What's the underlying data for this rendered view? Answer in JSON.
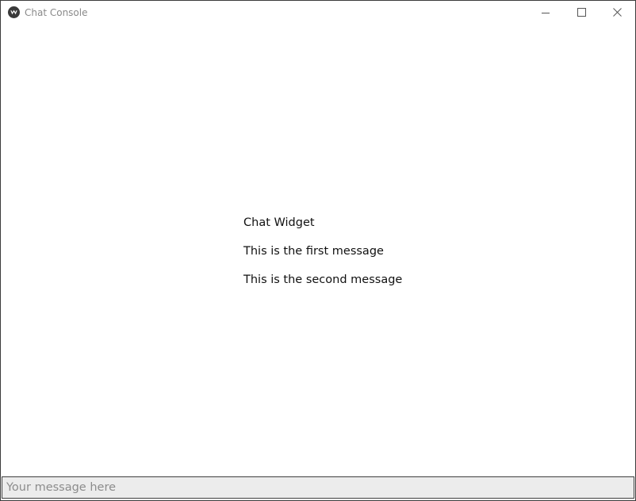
{
  "window": {
    "title": "Chat Console",
    "icon": "app-logo-icon",
    "controls": [
      "minimize-icon",
      "maximize-icon",
      "close-icon"
    ]
  },
  "chat": {
    "messages": [
      "Chat Widget",
      "This is the first message",
      "This is the second message"
    ]
  },
  "input": {
    "value": "",
    "placeholder": "Your message here"
  }
}
